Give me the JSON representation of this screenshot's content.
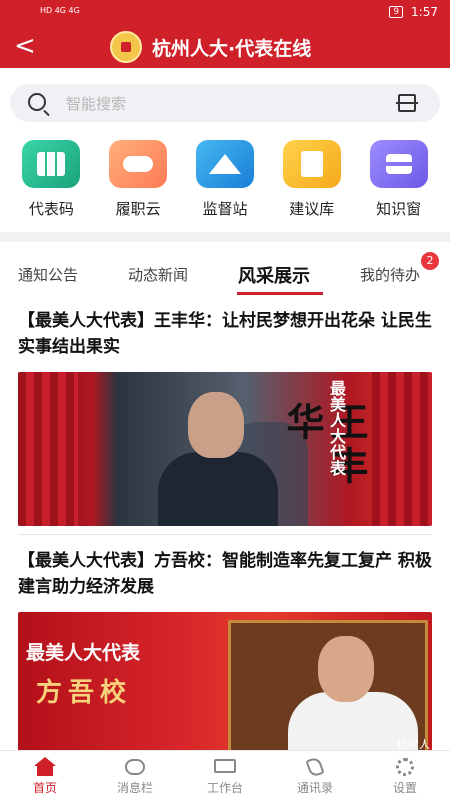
{
  "status": {
    "network_left": "HD 4G 4G",
    "time": "1:57",
    "battery": "9"
  },
  "header": {
    "title": "杭州人大·代表在线",
    "back_label": "<"
  },
  "search": {
    "placeholder": "智能搜索"
  },
  "quick_actions": [
    {
      "label": "代表码",
      "icon": "qr-grid-icon",
      "color": "#1ba27a"
    },
    {
      "label": "履职云",
      "icon": "cloud-icon",
      "color": "#ff7a54"
    },
    {
      "label": "监督站",
      "icon": "house-icon",
      "color": "#1a7ed6"
    },
    {
      "label": "建议库",
      "icon": "document-icon",
      "color": "#f6a91b"
    },
    {
      "label": "知识窗",
      "icon": "stack-icon",
      "color": "#6b59e6"
    }
  ],
  "tabs": [
    {
      "label": "通知公告",
      "active": false
    },
    {
      "label": "动态新闻",
      "active": false
    },
    {
      "label": "风采展示",
      "active": true
    },
    {
      "label": "我的待办",
      "active": false,
      "badge": "2"
    }
  ],
  "articles": [
    {
      "title": "【最美人大代表】王丰华：让村民梦想开出花朵 让民生实事结出果实",
      "image_vertical_text": "最美人大代表",
      "image_name": "王丰华"
    },
    {
      "title": "【最美人大代表】方吾校：智能制造率先复工复产 积极建言助力经济发展",
      "image_heading": "最美人大代表",
      "image_name": "方吾校",
      "image_watermark": "杭州人"
    }
  ],
  "bottom_nav": [
    {
      "label": "首页",
      "icon": "home-icon",
      "active": true
    },
    {
      "label": "消息栏",
      "icon": "message-icon",
      "active": false
    },
    {
      "label": "工作台",
      "icon": "desk-icon",
      "active": false
    },
    {
      "label": "通讯录",
      "icon": "phone-icon",
      "active": false
    },
    {
      "label": "设置",
      "icon": "gear-icon",
      "active": false
    }
  ],
  "colors": {
    "brand": "#d0202a",
    "badge": "#e8383d"
  }
}
